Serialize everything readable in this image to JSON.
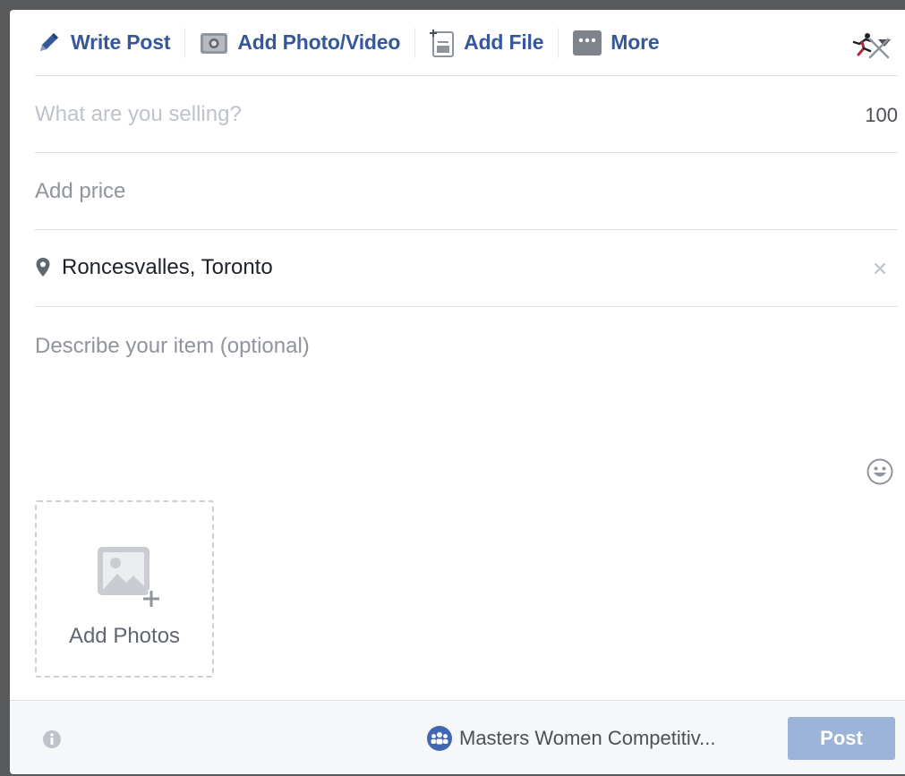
{
  "toolbar": {
    "write_post": "Write Post",
    "add_photo_video": "Add Photo/Video",
    "add_file": "Add File",
    "more": "More"
  },
  "form": {
    "title_placeholder": "What are you selling?",
    "char_count": "100",
    "price_placeholder": "Add price",
    "location": "Roncesvalles, Toronto",
    "description_placeholder": "Describe your item (optional)",
    "add_photos": "Add Photos"
  },
  "footer": {
    "audience": "Masters Women Competitiv...",
    "post": "Post"
  },
  "icons": {
    "write_post": "pencil-icon",
    "add_photo_video": "camera-icon",
    "add_file": "file-icon",
    "more": "more-icon",
    "profile": "runner-icon",
    "close": "close-icon",
    "location": "location-pin-icon",
    "clear": "clear-icon",
    "emoji": "emoji-icon",
    "add_photos": "add-photo-icon",
    "info": "info-icon",
    "audience": "group-icon"
  },
  "colors": {
    "link": "#365899",
    "post_button": "#9cb4d8",
    "placeholder": "#90949c",
    "footer_bg": "#f6f7f9",
    "group_badge": "#4267b2"
  }
}
